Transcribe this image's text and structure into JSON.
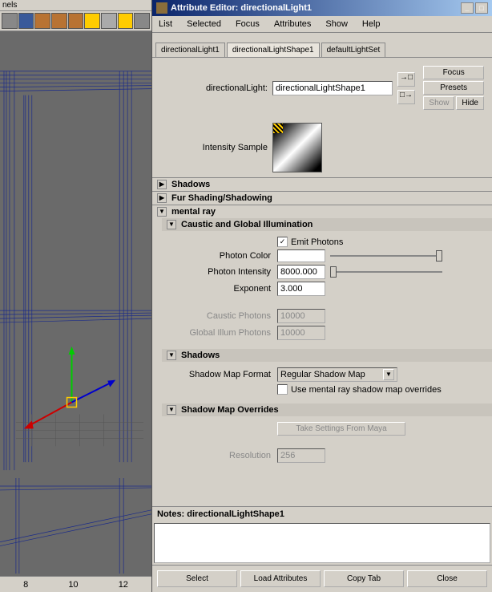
{
  "left": {
    "title": "nels",
    "timeline": [
      "8",
      "10",
      "12"
    ]
  },
  "titlebar": {
    "text": "Attribute Editor: directionalLight1"
  },
  "menu": [
    "List",
    "Selected",
    "Focus",
    "Attributes",
    "Show",
    "Help"
  ],
  "tabs": [
    {
      "label": "directionalLight1",
      "active": false
    },
    {
      "label": "directionalLightShape1",
      "active": true
    },
    {
      "label": "defaultLightSet",
      "active": false
    }
  ],
  "header": {
    "name_label": "directionalLight:",
    "name_value": "directionalLightShape1",
    "focus": "Focus",
    "presets": "Presets",
    "show": "Show",
    "hide": "Hide",
    "sample_label": "Intensity Sample"
  },
  "sections": {
    "shadows": "Shadows",
    "fur": "Fur Shading/Shadowing",
    "mentalray": "mental ray",
    "caustic": {
      "title": "Caustic and Global Illumination",
      "emit_label": "Emit Photons",
      "emit_checked": "✓",
      "photon_color_label": "Photon Color",
      "photon_intensity_label": "Photon Intensity",
      "photon_intensity_value": "8000.000",
      "exponent_label": "Exponent",
      "exponent_value": "3.000",
      "caustic_photons_label": "Caustic Photons",
      "caustic_photons_value": "10000",
      "global_illum_label": "Global Illum Photons",
      "global_illum_value": "10000"
    },
    "shadows2": {
      "title": "Shadows",
      "format_label": "Shadow Map Format",
      "format_value": "Regular Shadow Map",
      "use_overrides": "Use mental ray shadow map overrides"
    },
    "overrides": {
      "title": "Shadow Map Overrides",
      "take_settings": "Take Settings From Maya",
      "resolution_label": "Resolution",
      "resolution_value": "256"
    }
  },
  "notes": {
    "label": "Notes:  directionalLightShape1"
  },
  "bottom": {
    "select": "Select",
    "load": "Load Attributes",
    "copy": "Copy Tab",
    "close": "Close"
  }
}
